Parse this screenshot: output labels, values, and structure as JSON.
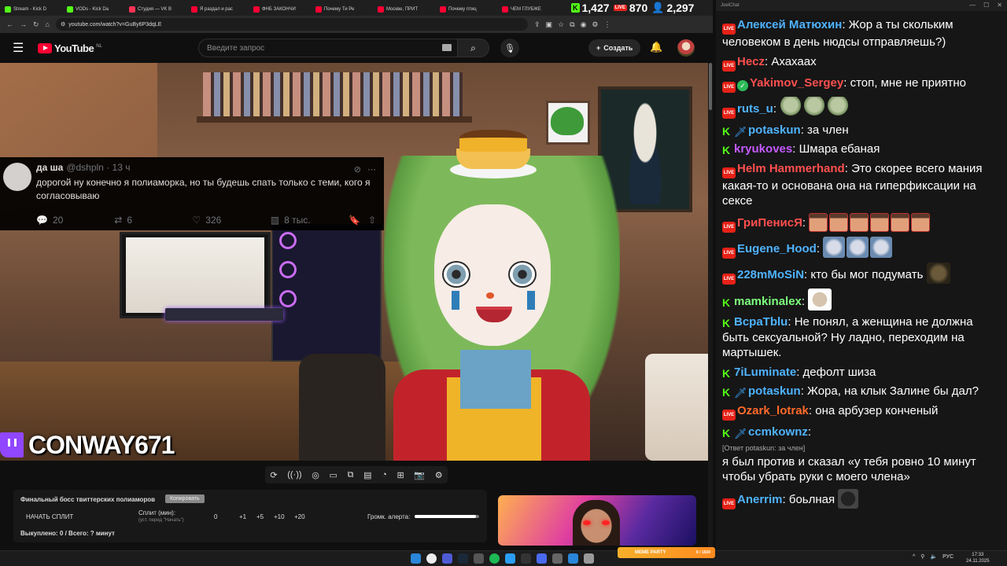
{
  "browser": {
    "tabs": [
      {
        "label": "Stream - Kick D",
        "icon": "kick",
        "active": false
      },
      {
        "label": "VODs - Kick Da",
        "icon": "kick",
        "active": false
      },
      {
        "label": "Студия — VK В",
        "icon": "vk",
        "active": false
      },
      {
        "label": "Я раздал и рас",
        "icon": "yt",
        "active": false
      },
      {
        "label": "ФНБ ЗАКОНЧИ",
        "icon": "yt",
        "active": false
      },
      {
        "label": "Почему Ти Ре",
        "icon": "yt",
        "active": false
      },
      {
        "label": "Москве, ПРИТ",
        "icon": "yt",
        "active": false
      },
      {
        "label": "Почему птиц",
        "icon": "yt",
        "active": false
      },
      {
        "label": "ЧЕМ ГЛУБЖЕ",
        "icon": "yt",
        "active": false
      }
    ],
    "url": "youtube.com/watch?v=GuBy6P3dqLE"
  },
  "viewer_overlay": {
    "kick_count": "1,427",
    "live_label": "LIVE",
    "live_count": "870",
    "twitch_count": "2,297"
  },
  "youtube": {
    "logo_text": "YouTube",
    "country": "NL",
    "search_placeholder": "Введите запрос",
    "create_label": "Создать"
  },
  "tweet": {
    "name": "да ша",
    "handle": "@dshpln · 13 ч",
    "text": "дорогой ну конечно я полиаморка, но ты будешь спать только с теми, кого я согласовываю",
    "replies": "20",
    "retweets": "6",
    "likes": "326",
    "views": "8 тыс."
  },
  "stream_brand": "CONWAY671",
  "split_panel": {
    "title": "Финальный босс твиттерских полиаморов",
    "copy_label": "Копировать",
    "start_label": "НАЧАТЬ СПЛИТ",
    "split_min_label": "Сплит (мин):",
    "split_hint": "(уст. перед \"Начать\")",
    "split_value": "0",
    "plus_buttons": [
      "+1",
      "+5",
      "+10",
      "+20"
    ],
    "alert_volume_label": "Громк. алерта:",
    "alert_volume": 0.95,
    "status": "Выкуплено: 0 / Всего: ? минут"
  },
  "chat": {
    "window_title": "JoelChat",
    "messages": [
      {
        "badges": [
          "live"
        ],
        "nick": "Алексей Матюхин",
        "color": "#4fb3ff",
        "text": "Жор а ты скольким человеком в день нюдсы отправляешь?)",
        "emotes": []
      },
      {
        "badges": [
          "live"
        ],
        "nick": "Hecz",
        "color": "#ff4f4f",
        "text": "Ахахаах",
        "emotes": []
      },
      {
        "badges": [
          "live",
          "mod"
        ],
        "nick": "Yakimov_Sergey",
        "color": "#ff4f4f",
        "text": "стоп, мне не приятно",
        "emotes": []
      },
      {
        "badges": [
          "live"
        ],
        "nick": "ruts_u",
        "color": "#4fb3ff",
        "text": "",
        "emotes": [
          "frog",
          "frog",
          "frog"
        ]
      },
      {
        "badges": [
          "kick",
          "sword"
        ],
        "nick": "potaskun",
        "color": "#4fb3ff",
        "text": "за член",
        "emotes": []
      },
      {
        "badges": [
          "kick"
        ],
        "nick": "kryukoves",
        "color": "#c45aff",
        "text": "Шмара ебаная",
        "emotes": []
      },
      {
        "badges": [
          "live"
        ],
        "nick": "Helm Hammerhand",
        "color": "#ff4f4f",
        "text": "Это скорее всего мания какая-то и основана она на гиперфиксации на сексе",
        "emotes": []
      },
      {
        "badges": [
          "live"
        ],
        "nick": "ГриПенисЯ",
        "color": "#ff4f4f",
        "text": "",
        "emotes": [
          "face",
          "face",
          "face",
          "face",
          "face",
          "face"
        ]
      },
      {
        "badges": [
          "live"
        ],
        "nick": "Eugene_Hood",
        "color": "#4fb3ff",
        "text": "",
        "emotes": [
          "fish",
          "fish",
          "fish"
        ]
      },
      {
        "badges": [
          "live"
        ],
        "nick": "228mMoSiN",
        "color": "#4fb3ff",
        "text": "кто бы мог подумать",
        "emotes": [
          "monkey"
        ]
      },
      {
        "badges": [
          "kick"
        ],
        "nick": "mamkinalex",
        "color": "#7dff7d",
        "text": "",
        "emotes": [
          "cat"
        ]
      },
      {
        "badges": [
          "kick"
        ],
        "nick": "BcpaTblu",
        "color": "#4fb3ff",
        "text": "Не понял, а женщина не должна быть сексуальной? Ну ладно, переходим на мартышек.",
        "emotes": []
      },
      {
        "badges": [
          "kick"
        ],
        "nick": "7iLuminate",
        "color": "#4fb3ff",
        "text": "дефолт шиза",
        "emotes": []
      },
      {
        "badges": [
          "kick",
          "sword"
        ],
        "nick": "potaskun",
        "color": "#4fb3ff",
        "text": "Жора, на клык Залине бы дал?",
        "emotes": []
      },
      {
        "badges": [
          "live"
        ],
        "nick": "Ozark_lotrak",
        "color": "#ff6a2a",
        "text": "она арбузер конченый",
        "emotes": []
      },
      {
        "badges": [
          "kick",
          "sword"
        ],
        "nick": "ccmkownz",
        "color": "#4fb3ff",
        "text": "",
        "emotes": [],
        "reply": "[Ответ potaskun: за член]",
        "after": "я был против и сказал «у тебя ровно 10 минут чтобы убрать руки с моего члена»"
      },
      {
        "badges": [
          "live"
        ],
        "nick": "Anerrim",
        "color": "#4fb3ff",
        "text": "боьлная",
        "emotes": [
          "dog"
        ]
      }
    ]
  },
  "taskbar": {
    "widget_label": "MEME PARTY",
    "widget_count": "0 / 1500",
    "lang": "РУС",
    "time": "17:33",
    "date": "24.11.2025"
  }
}
